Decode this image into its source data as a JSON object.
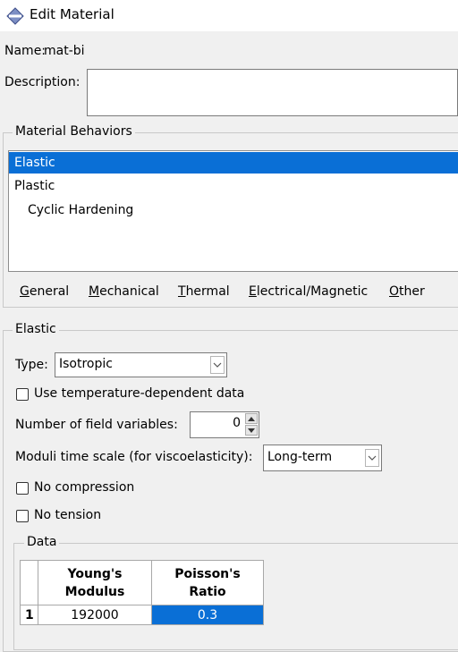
{
  "window": {
    "title": "Edit Material",
    "icon": "material-diamond-icon"
  },
  "name": {
    "label": "Name:",
    "value": "mat-bi"
  },
  "description": {
    "label": "Description:",
    "value": ""
  },
  "behaviors": {
    "legend": "Material Behaviors",
    "items": [
      {
        "label": "Elastic",
        "selected": true,
        "indent": 0
      },
      {
        "label": "Plastic",
        "selected": false,
        "indent": 0
      },
      {
        "label": "Cyclic Hardening",
        "selected": false,
        "indent": 1
      }
    ],
    "menus": [
      {
        "label": "General",
        "mnemonic": "G",
        "rest": "eneral"
      },
      {
        "label": "Mechanical",
        "mnemonic": "M",
        "rest": "echanical"
      },
      {
        "label": "Thermal",
        "mnemonic": "T",
        "rest": "hermal"
      },
      {
        "label": "Electrical/Magnetic",
        "mnemonic": "E",
        "rest": "lectrical/Magnetic"
      },
      {
        "label": "Other",
        "mnemonic": "O",
        "rest": "ther"
      }
    ]
  },
  "elastic": {
    "legend": "Elastic",
    "type_label": "Type:",
    "type_value": "Isotropic",
    "temp_dependent_label": "Use temperature-dependent data",
    "temp_dependent_checked": false,
    "field_vars_label": "Number of field variables:",
    "field_vars_value": "0",
    "moduli_label": "Moduli time scale (for viscoelasticity):",
    "moduli_value": "Long-term",
    "no_compression_label": "No compression",
    "no_compression_checked": false,
    "no_tension_label": "No tension",
    "no_tension_checked": false
  },
  "data_table": {
    "legend": "Data",
    "columns": [
      {
        "line1": "Young's",
        "line2": "Modulus"
      },
      {
        "line1": "Poisson's",
        "line2": "Ratio"
      }
    ],
    "rows": [
      {
        "index": "1",
        "cells": [
          "192000",
          "0.3"
        ]
      }
    ]
  },
  "colors": {
    "selection": "#0a6fd6",
    "background": "#f0f0f0"
  }
}
